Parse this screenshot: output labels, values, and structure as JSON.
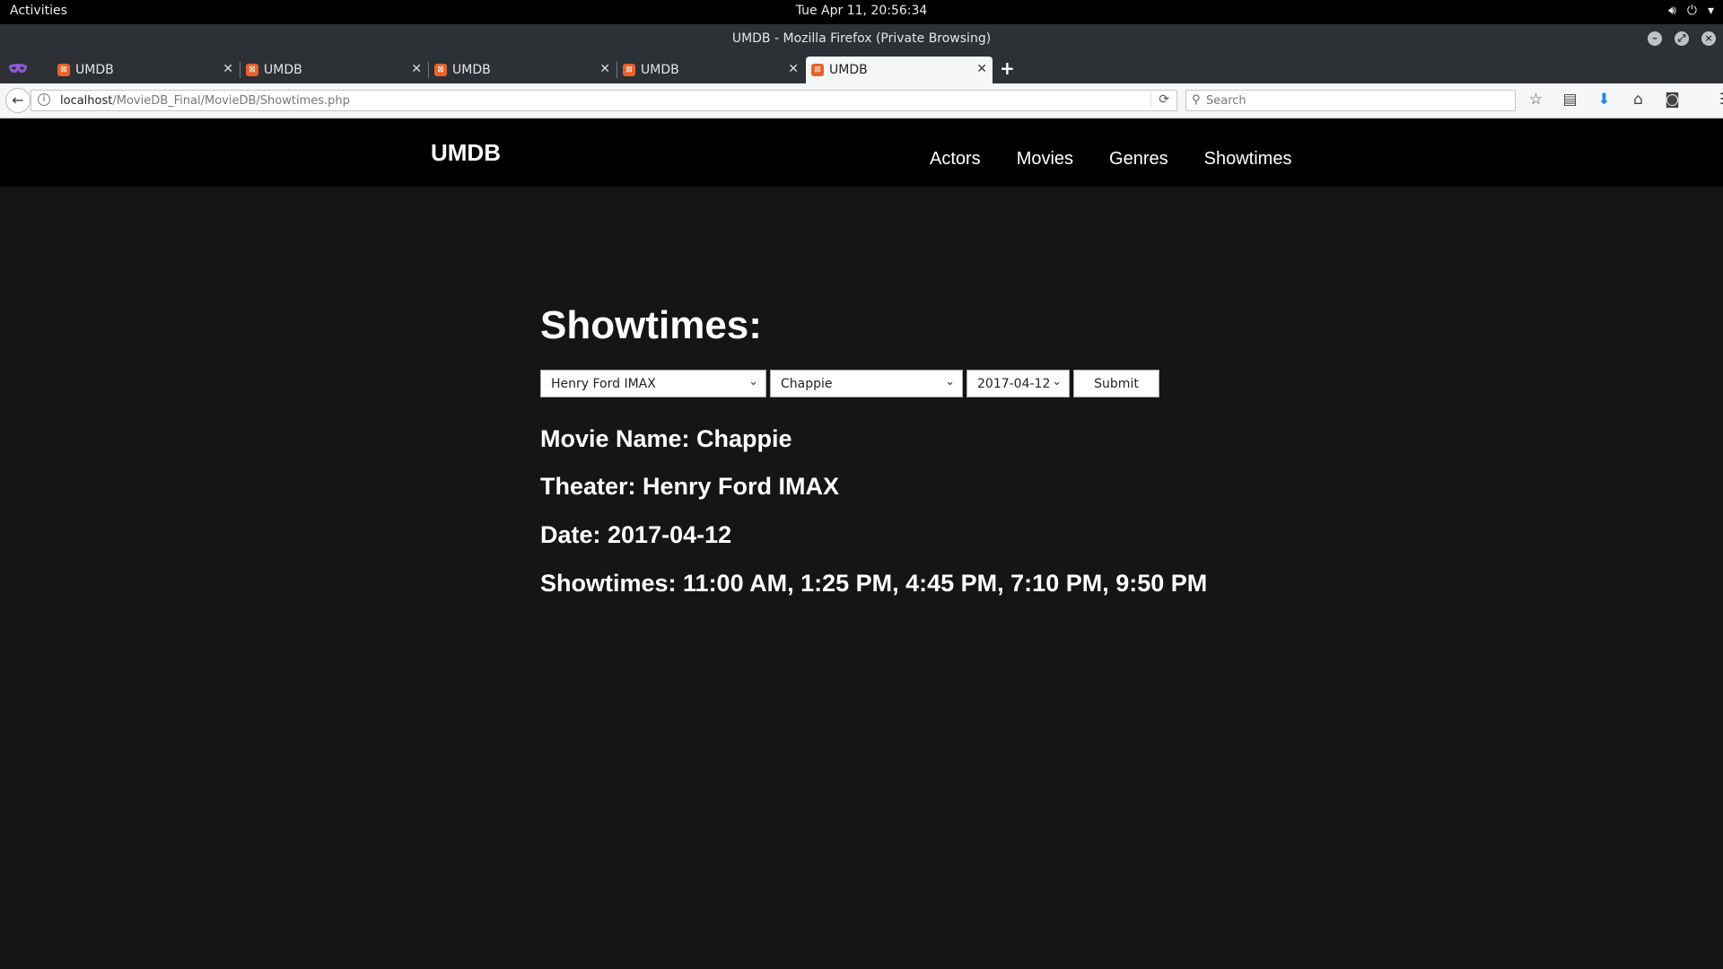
{
  "system": {
    "activities": "Activities",
    "clock": "Tue Apr 11, 20:56:34"
  },
  "window": {
    "title": "UMDB - Mozilla Firefox (Private Browsing)"
  },
  "tabs": [
    {
      "label": "UMDB"
    },
    {
      "label": "UMDB"
    },
    {
      "label": "UMDB"
    },
    {
      "label": "UMDB"
    },
    {
      "label": "UMDB"
    }
  ],
  "address": {
    "host": "localhost",
    "path": "/MovieDB_Final/MovieDB/Showtimes.php"
  },
  "search": {
    "placeholder": "Search"
  },
  "site": {
    "brand": "UMDB",
    "nav": [
      "Actors",
      "Movies",
      "Genres",
      "Showtimes"
    ]
  },
  "main": {
    "heading": "Showtimes:",
    "theater_select": "Henry Ford IMAX",
    "movie_select": "Chappie",
    "date_select": "2017-04-12",
    "submit_label": "Submit",
    "movie_line": "Movie Name: Chappie",
    "theater_line": "Theater: Henry Ford IMAX",
    "date_line": "Date: 2017-04-12",
    "showtimes_line": "Showtimes: 11:00 AM, 1:25 PM, 4:45 PM, 7:10 PM, 9:50 PM"
  },
  "colors": {
    "page_bg": "#151515",
    "nav_bg": "#000000",
    "favicon": "#e8632b",
    "download_accent": "#1e88e5"
  }
}
